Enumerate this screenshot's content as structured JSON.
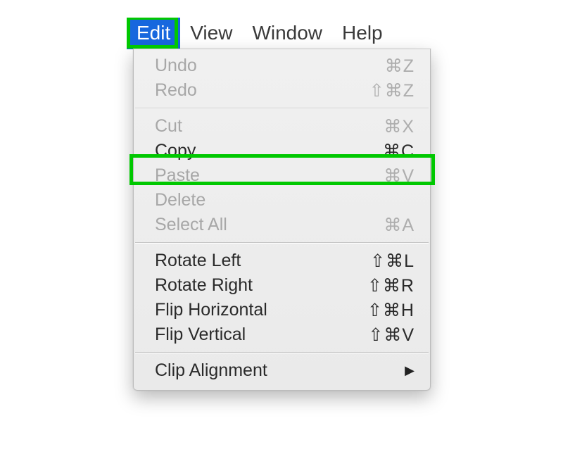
{
  "colors": {
    "highlight": "#00c800",
    "menu_selected_bg": "#1767de"
  },
  "menubar": {
    "items": [
      {
        "label": "Edit",
        "selected": true
      },
      {
        "label": "View",
        "selected": false
      },
      {
        "label": "Window",
        "selected": false
      },
      {
        "label": "Help",
        "selected": false
      }
    ]
  },
  "dropdown": {
    "groups": [
      [
        {
          "name": "undo",
          "label": "Undo",
          "shortcut": "⌘Z",
          "enabled": false
        },
        {
          "name": "redo",
          "label": "Redo",
          "shortcut": "⇧⌘Z",
          "enabled": false
        }
      ],
      [
        {
          "name": "cut",
          "label": "Cut",
          "shortcut": "⌘X",
          "enabled": false
        },
        {
          "name": "copy",
          "label": "Copy",
          "shortcut": "⌘C",
          "enabled": true
        },
        {
          "name": "paste",
          "label": "Paste",
          "shortcut": "⌘V",
          "enabled": false
        },
        {
          "name": "delete",
          "label": "Delete",
          "shortcut": "",
          "enabled": false
        },
        {
          "name": "selectall",
          "label": "Select All",
          "shortcut": "⌘A",
          "enabled": false
        }
      ],
      [
        {
          "name": "rotate-left",
          "label": "Rotate Left",
          "shortcut": "⇧⌘L",
          "enabled": true
        },
        {
          "name": "rotate-right",
          "label": "Rotate Right",
          "shortcut": "⇧⌘R",
          "enabled": true
        },
        {
          "name": "flip-horizontal",
          "label": "Flip Horizontal",
          "shortcut": "⇧⌘H",
          "enabled": true
        },
        {
          "name": "flip-vertical",
          "label": "Flip Vertical",
          "shortcut": "⇧⌘V",
          "enabled": true
        }
      ],
      [
        {
          "name": "clip-alignment",
          "label": "Clip Alignment",
          "shortcut": "",
          "enabled": true,
          "submenu": true
        }
      ]
    ]
  }
}
